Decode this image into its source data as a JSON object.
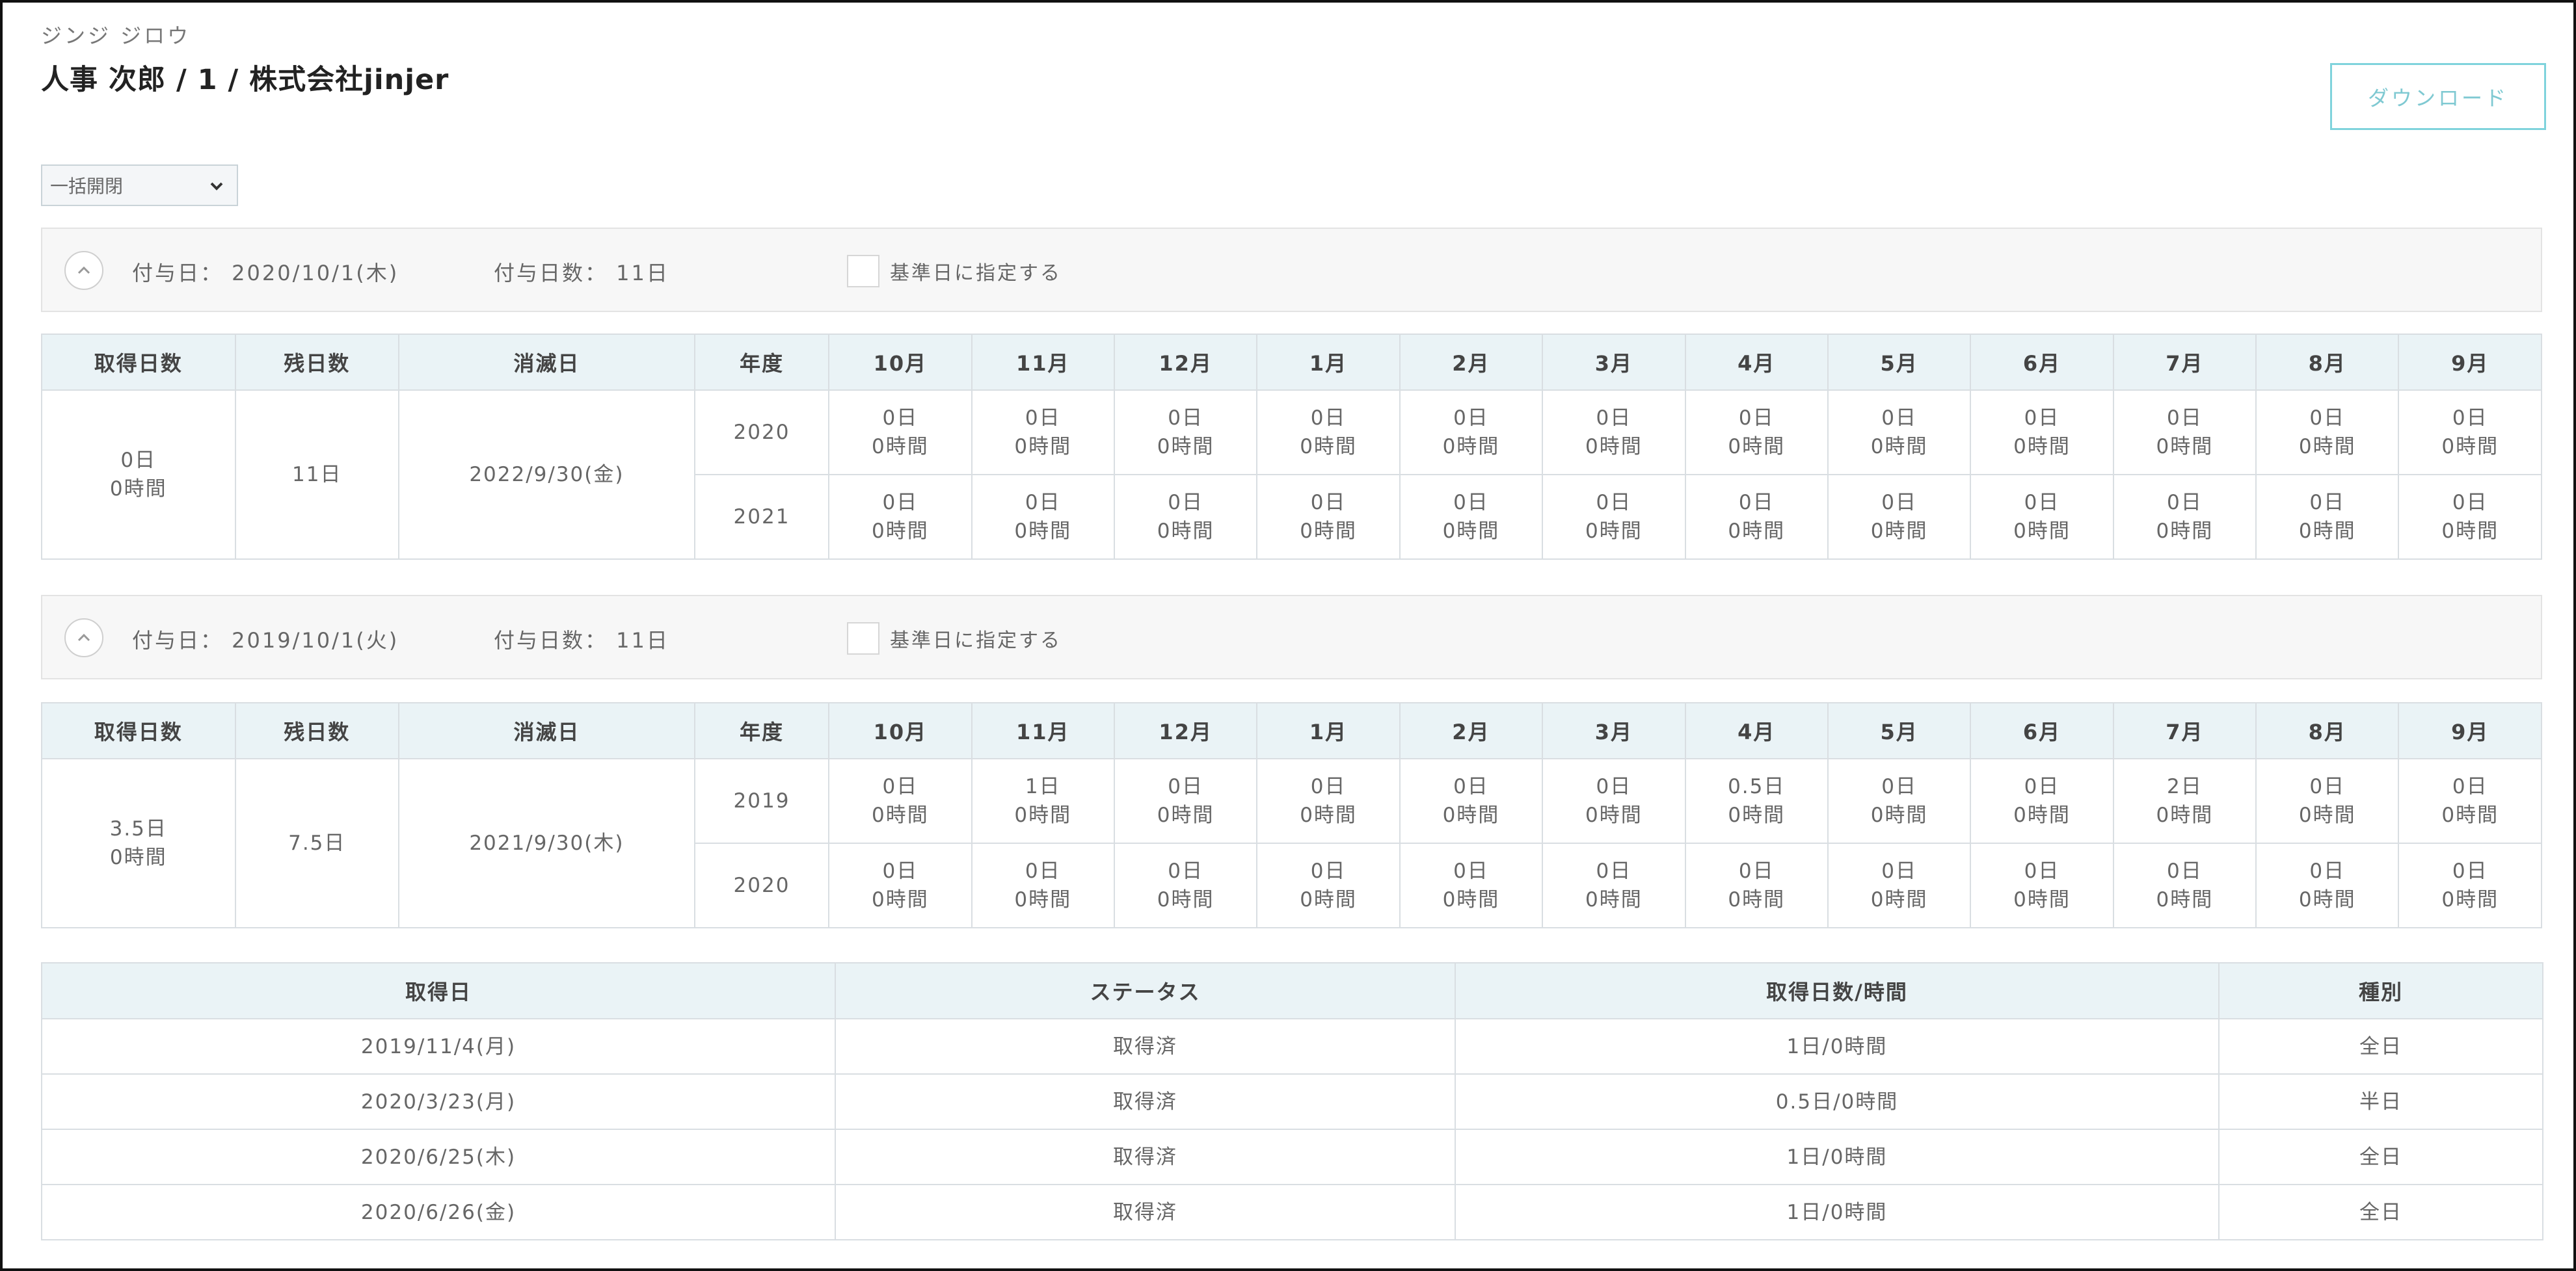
{
  "header": {
    "name_kana": "ジンジ ジロウ",
    "title": "人事 次郎 / 1 / 株式会社jinjer",
    "download_label": "ダウンロード"
  },
  "bulk_select": {
    "value": "一括開閉"
  },
  "grant_columns": {
    "acquired": "取得日数",
    "remaining": "残日数",
    "expiry": "消滅日",
    "fiscal_year": "年度",
    "months": [
      "10月",
      "11月",
      "12月",
      "1月",
      "2月",
      "3月",
      "4月",
      "5月",
      "6月",
      "7月",
      "8月",
      "9月"
    ]
  },
  "grants": [
    {
      "grant_date": "付与日： 2020/10/1(木)",
      "grant_days": "付与日数： 11日",
      "set_base_label": "基準日に指定する",
      "acquired_days": "0日",
      "acquired_hours": "0時間",
      "remaining": "11日",
      "expiry": "2022/9/30(金)",
      "years": [
        {
          "year": "2020",
          "cells": [
            [
              "0日",
              "0時間"
            ],
            [
              "0日",
              "0時間"
            ],
            [
              "0日",
              "0時間"
            ],
            [
              "0日",
              "0時間"
            ],
            [
              "0日",
              "0時間"
            ],
            [
              "0日",
              "0時間"
            ],
            [
              "0日",
              "0時間"
            ],
            [
              "0日",
              "0時間"
            ],
            [
              "0日",
              "0時間"
            ],
            [
              "0日",
              "0時間"
            ],
            [
              "0日",
              "0時間"
            ],
            [
              "0日",
              "0時間"
            ]
          ]
        },
        {
          "year": "2021",
          "cells": [
            [
              "0日",
              "0時間"
            ],
            [
              "0日",
              "0時間"
            ],
            [
              "0日",
              "0時間"
            ],
            [
              "0日",
              "0時間"
            ],
            [
              "0日",
              "0時間"
            ],
            [
              "0日",
              "0時間"
            ],
            [
              "0日",
              "0時間"
            ],
            [
              "0日",
              "0時間"
            ],
            [
              "0日",
              "0時間"
            ],
            [
              "0日",
              "0時間"
            ],
            [
              "0日",
              "0時間"
            ],
            [
              "0日",
              "0時間"
            ]
          ]
        }
      ]
    },
    {
      "grant_date": "付与日： 2019/10/1(火)",
      "grant_days": "付与日数： 11日",
      "set_base_label": "基準日に指定する",
      "acquired_days": "3.5日",
      "acquired_hours": "0時間",
      "remaining": "7.5日",
      "expiry": "2021/9/30(木)",
      "years": [
        {
          "year": "2019",
          "cells": [
            [
              "0日",
              "0時間"
            ],
            [
              "1日",
              "0時間"
            ],
            [
              "0日",
              "0時間"
            ],
            [
              "0日",
              "0時間"
            ],
            [
              "0日",
              "0時間"
            ],
            [
              "0日",
              "0時間"
            ],
            [
              "0.5日",
              "0時間"
            ],
            [
              "0日",
              "0時間"
            ],
            [
              "0日",
              "0時間"
            ],
            [
              "2日",
              "0時間"
            ],
            [
              "0日",
              "0時間"
            ],
            [
              "0日",
              "0時間"
            ]
          ]
        },
        {
          "year": "2020",
          "cells": [
            [
              "0日",
              "0時間"
            ],
            [
              "0日",
              "0時間"
            ],
            [
              "0日",
              "0時間"
            ],
            [
              "0日",
              "0時間"
            ],
            [
              "0日",
              "0時間"
            ],
            [
              "0日",
              "0時間"
            ],
            [
              "0日",
              "0時間"
            ],
            [
              "0日",
              "0時間"
            ],
            [
              "0日",
              "0時間"
            ],
            [
              "0日",
              "0時間"
            ],
            [
              "0日",
              "0時間"
            ],
            [
              "0日",
              "0時間"
            ]
          ]
        }
      ]
    }
  ],
  "history": {
    "columns": [
      "取得日",
      "ステータス",
      "取得日数/時間",
      "種別"
    ],
    "rows": [
      [
        "2019/11/4(月)",
        "取得済",
        "1日/0時間",
        "全日"
      ],
      [
        "2020/3/23(月)",
        "取得済",
        "0.5日/0時間",
        "半日"
      ],
      [
        "2020/6/25(木)",
        "取得済",
        "1日/0時間",
        "全日"
      ],
      [
        "2020/6/26(金)",
        "取得済",
        "1日/0時間",
        "全日"
      ]
    ]
  }
}
